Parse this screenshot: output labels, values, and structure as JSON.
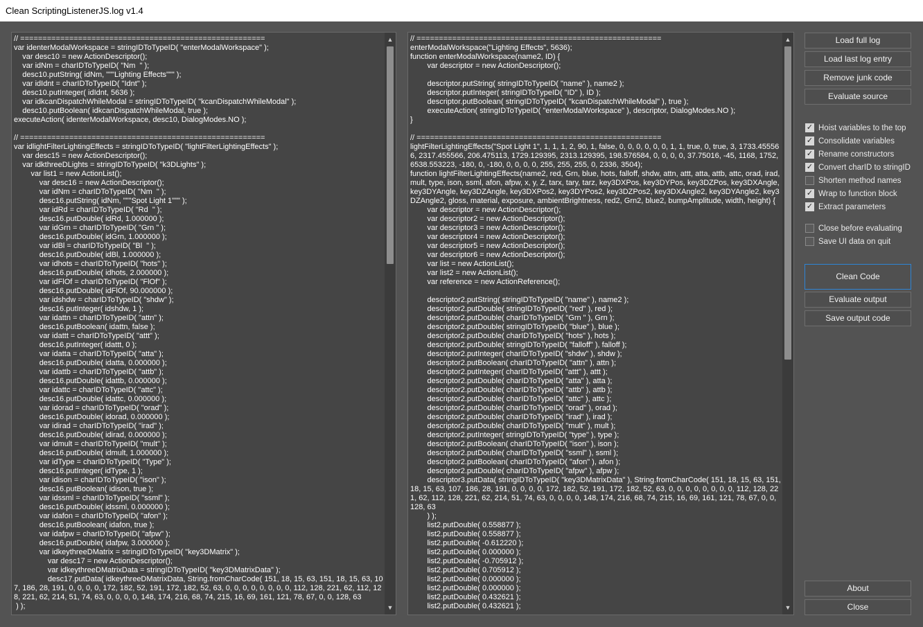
{
  "window": {
    "title": "Clean ScriptingListenerJS.log v1.4"
  },
  "left_editor": {
    "code": "// =======================================================\nvar identerModalWorkspace = stringIDToTypeID( \"enterModalWorkspace\" );\n    var desc10 = new ActionDescriptor();\n    var idNm = charIDToTypeID( \"Nm  \" );\n    desc10.putString( idNm, \"\"\"Lighting Effects\"\"\" );\n    var idIdnt = charIDToTypeID( \"Idnt\" );\n    desc10.putInteger( idIdnt, 5636 );\n    var idkcanDispatchWhileModal = stringIDToTypeID( \"kcanDispatchWhileModal\" );\n    desc10.putBoolean( idkcanDispatchWhileModal, true );\nexecuteAction( identerModalWorkspace, desc10, DialogModes.NO );\n\n// =======================================================\nvar idlightFilterLightingEffects = stringIDToTypeID( \"lightFilterLightingEffects\" );\n    var desc15 = new ActionDescriptor();\n    var idkthreeDLights = stringIDToTypeID( \"k3DLights\" );\n        var list1 = new ActionList();\n            var desc16 = new ActionDescriptor();\n            var idNm = charIDToTypeID( \"Nm  \" );\n            desc16.putString( idNm, \"\"\"Spot Light 1\"\"\" );\n            var idRd = charIDToTypeID( \"Rd  \" );\n            desc16.putDouble( idRd, 1.000000 );\n            var idGrn = charIDToTypeID( \"Grn \" );\n            desc16.putDouble( idGrn, 1.000000 );\n            var idBl = charIDToTypeID( \"Bl  \" );\n            desc16.putDouble( idBl, 1.000000 );\n            var idhots = charIDToTypeID( \"hots\" );\n            desc16.putDouble( idhots, 2.000000 );\n            var idFlOf = charIDToTypeID( \"FlOf\" );\n            desc16.putDouble( idFlOf, 90.000000 );\n            var idshdw = charIDToTypeID( \"shdw\" );\n            desc16.putInteger( idshdw, 1 );\n            var idattn = charIDToTypeID( \"attn\" );\n            desc16.putBoolean( idattn, false );\n            var idattt = charIDToTypeID( \"attt\" );\n            desc16.putInteger( idattt, 0 );\n            var idatta = charIDToTypeID( \"atta\" );\n            desc16.putDouble( idatta, 0.000000 );\n            var idattb = charIDToTypeID( \"attb\" );\n            desc16.putDouble( idattb, 0.000000 );\n            var idattc = charIDToTypeID( \"attc\" );\n            desc16.putDouble( idattc, 0.000000 );\n            var idorad = charIDToTypeID( \"orad\" );\n            desc16.putDouble( idorad, 0.000000 );\n            var idirad = charIDToTypeID( \"irad\" );\n            desc16.putDouble( idirad, 0.000000 );\n            var idmult = charIDToTypeID( \"mult\" );\n            desc16.putDouble( idmult, 1.000000 );\n            var idType = charIDToTypeID( \"Type\" );\n            desc16.putInteger( idType, 1 );\n            var idison = charIDToTypeID( \"ison\" );\n            desc16.putBoolean( idison, true );\n            var idssml = charIDToTypeID( \"ssml\" );\n            desc16.putDouble( idssml, 0.000000 );\n            var idafon = charIDToTypeID( \"afon\" );\n            desc16.putBoolean( idafon, true );\n            var idafpw = charIDToTypeID( \"afpw\" );\n            desc16.putDouble( idafpw, 3.000000 );\n            var idkeythreeDMatrix = stringIDToTypeID( \"key3DMatrix\" );\n                var desc17 = new ActionDescriptor();\n                var idkeythreeDMatrixData = stringIDToTypeID( \"key3DMatrixData\" );\n                desc17.putData( idkeythreeDMatrixData, String.fromCharCode( 151, 18, 15, 63, 151, 18, 15, 63, 107, 186, 28, 191, 0, 0, 0, 0, 172, 182, 52, 191, 172, 182, 52, 63, 0, 0, 0, 0, 0, 0, 0, 0, 112, 128, 221, 62, 112, 128, 221, 62, 214, 51, 74, 63, 0, 0, 0, 0, 148, 174, 216, 68, 74, 215, 16, 69, 161, 121, 78, 67, 0, 0, 128, 63\n ) );"
  },
  "right_editor": {
    "code": "// =======================================================\nenterModalWorkspace(\"Lighting Effects\", 5636);\nfunction enterModalWorkspace(name2, ID) {\n\tvar descriptor = new ActionDescriptor();\n\n\tdescriptor.putString( stringIDToTypeID( \"name\" ), name2 );\n\tdescriptor.putInteger( stringIDToTypeID( \"ID\" ), ID );\n\tdescriptor.putBoolean( stringIDToTypeID( \"kcanDispatchWhileModal\" ), true );\n\texecuteAction( stringIDToTypeID( \"enterModalWorkspace\" ), descriptor, DialogModes.NO );\n}\n\n// =======================================================\nlightFilterLightingEffects(\"Spot Light 1\", 1, 1, 1, 2, 90, 1, false, 0, 0, 0, 0, 0, 0, 1, 1, true, 0, true, 3, 1733.455566, 2317.455566, 206.475113, 1729.129395, 2313.129395, 198.576584, 0, 0, 0, 0, 37.75016, -45, 1168, 1752, 6538.553223, -180, 0, -180, 0, 0, 0, 0, 255, 255, 255, 0, 2336, 3504);\nfunction lightFilterLightingEffects(name2, red, Grn, blue, hots, falloff, shdw, attn, attt, atta, attb, attc, orad, irad, mult, type, ison, ssml, afon, afpw, x, y, Z, tarx, tary, tarz, key3DXPos, key3DYPos, key3DZPos, key3DXAngle, key3DYAngle, key3DZAngle, key3DXPos2, key3DYPos2, key3DZPos2, key3DXAngle2, key3DYAngle2, key3DZAngle2, gloss, material, exposure, ambientBrightness, red2, Grn2, blue2, bumpAmplitude, width, height) {\n\tvar descriptor = new ActionDescriptor();\n\tvar descriptor2 = new ActionDescriptor();\n\tvar descriptor3 = new ActionDescriptor();\n\tvar descriptor4 = new ActionDescriptor();\n\tvar descriptor5 = new ActionDescriptor();\n\tvar descriptor6 = new ActionDescriptor();\n\tvar list = new ActionList();\n\tvar list2 = new ActionList();\n\tvar reference = new ActionReference();\n\n\tdescriptor2.putString( stringIDToTypeID( \"name\" ), name2 );\n\tdescriptor2.putDouble( stringIDToTypeID( \"red\" ), red );\n\tdescriptor2.putDouble( charIDToTypeID( \"Grn \" ), Grn );\n\tdescriptor2.putDouble( stringIDToTypeID( \"blue\" ), blue );\n\tdescriptor2.putDouble( charIDToTypeID( \"hots\" ), hots );\n\tdescriptor2.putDouble( stringIDToTypeID( \"falloff\" ), falloff );\n\tdescriptor2.putInteger( charIDToTypeID( \"shdw\" ), shdw );\n\tdescriptor2.putBoolean( charIDToTypeID( \"attn\" ), attn );\n\tdescriptor2.putInteger( charIDToTypeID( \"attt\" ), attt );\n\tdescriptor2.putDouble( charIDToTypeID( \"atta\" ), atta );\n\tdescriptor2.putDouble( charIDToTypeID( \"attb\" ), attb );\n\tdescriptor2.putDouble( charIDToTypeID( \"attc\" ), attc );\n\tdescriptor2.putDouble( charIDToTypeID( \"orad\" ), orad );\n\tdescriptor2.putDouble( charIDToTypeID( \"irad\" ), irad );\n\tdescriptor2.putDouble( charIDToTypeID( \"mult\" ), mult );\n\tdescriptor2.putInteger( stringIDToTypeID( \"type\" ), type );\n\tdescriptor2.putBoolean( charIDToTypeID( \"ison\" ), ison );\n\tdescriptor2.putDouble( charIDToTypeID( \"ssml\" ), ssml );\n\tdescriptor2.putBoolean( charIDToTypeID( \"afon\" ), afon );\n\tdescriptor2.putDouble( charIDToTypeID( \"afpw\" ), afpw );\n\tdescriptor3.putData( stringIDToTypeID( \"key3DMatrixData\" ), String.fromCharCode( 151, 18, 15, 63, 151, 18, 15, 63, 107, 186, 28, 191, 0, 0, 0, 0, 172, 182, 52, 191, 172, 182, 52, 63, 0, 0, 0, 0, 0, 0, 0, 0, 112, 128, 221, 62, 112, 128, 221, 62, 214, 51, 74, 63, 0, 0, 0, 0, 148, 174, 216, 68, 74, 215, 16, 69, 161, 121, 78, 67, 0, 0, 128, 63\n\t) );\n\tlist2.putDouble( 0.558877 );\n\tlist2.putDouble( 0.558877 );\n\tlist2.putDouble( -0.612220 );\n\tlist2.putDouble( 0.000000 );\n\tlist2.putDouble( -0.705912 );\n\tlist2.putDouble( 0.705912 );\n\tlist2.putDouble( 0.000000 );\n\tlist2.putDouble( 0.000000 );\n\tlist2.putDouble( 0.432621 );\n\tlist2.putDouble( 0.432621 );"
  },
  "buttons": {
    "load_full_log": "Load full log",
    "load_last_log_entry": "Load last log entry",
    "remove_junk_code": "Remove junk code",
    "evaluate_source": "Evaluate source",
    "clean_code": "Clean Code",
    "evaluate_output": "Evaluate output",
    "save_output_code": "Save output code",
    "about": "About",
    "close": "Close"
  },
  "options": [
    {
      "label": "Hoist variables to the top",
      "checked": true
    },
    {
      "label": "Consolidate variables",
      "checked": true
    },
    {
      "label": "Rename constructors",
      "checked": true
    },
    {
      "label": "Convert charID to stringID",
      "checked": true
    },
    {
      "label": "Shorten method names",
      "checked": false
    },
    {
      "label": "Wrap to function block",
      "checked": true
    },
    {
      "label": "Extract parameters",
      "checked": true
    },
    {
      "label": "Close before evaluating",
      "checked": false
    },
    {
      "label": "Save UI data on quit",
      "checked": false
    }
  ],
  "colors": {
    "background": "#535353",
    "editor_background": "#454545",
    "focus_border": "#2e85d6"
  }
}
